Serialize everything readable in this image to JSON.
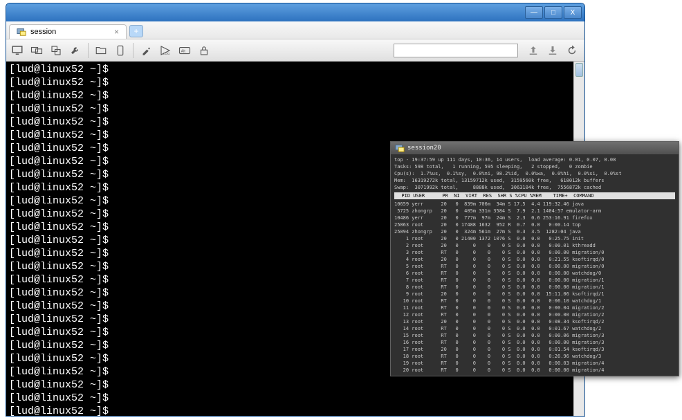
{
  "window": {
    "tab_title": "session",
    "minimize": "—",
    "maximize": "□",
    "close": "X",
    "newtab": "+"
  },
  "toolbar": {
    "search_placeholder": ""
  },
  "terminal": {
    "prompt": "[lud@linux52 ~]$",
    "lines": 27
  },
  "popup": {
    "title": "session20",
    "summary": [
      "top - 19:37:59 up 111 days, 10:36, 14 users,  load average: 0.01, 0.07, 0.08",
      "Tasks: 598 total,   1 running, 595 sleeping,   2 stopped,   0 zombie",
      "Cpu(s):  1.7%us,  0.1%sy,  0.0%ni, 98.2%id,  0.0%wa,  0.0%hi,  0.0%si,  0.0%st",
      "Mem:  16319272k total, 13159712k used,  3159560k free,   618012k buffers",
      "Swap:  3071992k total,     8888k used,  3063104k free,  7556872k cached"
    ],
    "header": "  PID USER      PR  NI  VIRT  RES  SHR S %CPU %MEM    TIME+  COMMAND",
    "rows": [
      "10659 yerr      20   0  839m 706m  34m S 17.5  4.4 119:32.46 java",
      " 5725 zhongrp   20   0  405m 331m 3584 S  7.9  2.1 1404:57 emulator-arm",
      "10486 yerr      20   0  777m  97m  24m S  2.3  0.6 253:16.91 firefox",
      "25863 root      20   0 17488 1632  952 R  0.7  0.0   0:00.14 top",
      "25094 zhongrp   20   0  324m 561m  27m S  0.3  3.5  1282:04 java",
      "    1 root      20   0 21400 1372 1076 S  0.0  0.0   0:25.75 init",
      "    2 root      20   0     0    0    0 S  0.0  0.0   0:00.01 kthreadd",
      "    3 root      RT   0     0    0    0 S  0.0  0.0   0:00.00 migration/0",
      "    4 root      20   0     0    0    0 S  0.0  0.0   0:21.55 ksoftirqd/0",
      "    5 root      RT   0     0    0    0 S  0.0  0.0   0:00.00 migration/0",
      "    6 root      RT   0     0    0    0 S  0.0  0.0   0:00.00 watchdog/0",
      "    7 root      RT   0     0    0    0 S  0.0  0.0   0:00.00 migration/1",
      "    8 root      RT   0     0    0    0 S  0.0  0.0   0:00.00 migration/1",
      "    9 root      20   0     0    0    0 S  0.0  0.0  15:11.06 ksoftirqd/1",
      "   10 root      RT   0     0    0    0 S  0.0  0.0   0:06.10 watchdog/1",
      "   11 root      RT   0     0    0    0 S  0.0  0.0   0:00.04 migration/2",
      "   12 root      RT   0     0    0    0 S  0.0  0.0   0:00.00 migration/2",
      "   13 root      20   0     0    0    0 S  0.0  0.0   0:08.34 ksoftirqd/2",
      "   14 root      RT   0     0    0    0 S  0.0  0.0   0:01.67 watchdog/2",
      "   15 root      RT   0     0    0    0 S  0.0  0.0   0:00.06 migration/3",
      "   16 root      RT   0     0    0    0 S  0.0  0.0   0:00.00 migration/3",
      "   17 root      20   0     0    0    0 S  0.0  0.0   0:01.54 ksoftirqd/3",
      "   18 root      RT   0     0    0    0 S  0.0  0.0   0:26.96 watchdog/3",
      "   19 root      RT   0     0    0    0 S  0.0  0.0   0:00.03 migration/4",
      "   20 root      RT   0     0    0    0 S  0.0  0.0   0:00.00 migration/4"
    ]
  }
}
